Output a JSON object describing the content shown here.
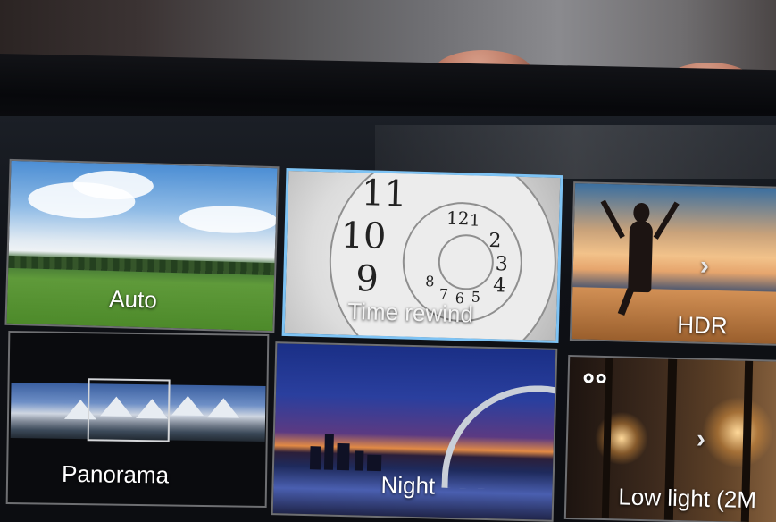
{
  "camera_modes": {
    "tiles": [
      {
        "id": "auto",
        "label": "Auto"
      },
      {
        "id": "time-rewind",
        "label": "Time rewind",
        "selected": true
      },
      {
        "id": "hdr",
        "label": "HDR"
      },
      {
        "id": "panorama",
        "label": "Panorama"
      },
      {
        "id": "night",
        "label": "Night"
      },
      {
        "id": "low-light",
        "label": "Low light (2M"
      }
    ],
    "clock_numbers": [
      "11",
      "12",
      "10",
      "9",
      "1",
      "2",
      "3",
      "4",
      "5",
      "6",
      "7",
      "8"
    ]
  },
  "icons": {
    "hdr_more": "chevron-right-icon",
    "low_light_more": "chevron-right-icon",
    "low_light_badge": "owl-icon"
  },
  "colors": {
    "selected_border": "#7ec3f4",
    "tile_border": "#6e6f72",
    "label_text": "#ffffff"
  }
}
